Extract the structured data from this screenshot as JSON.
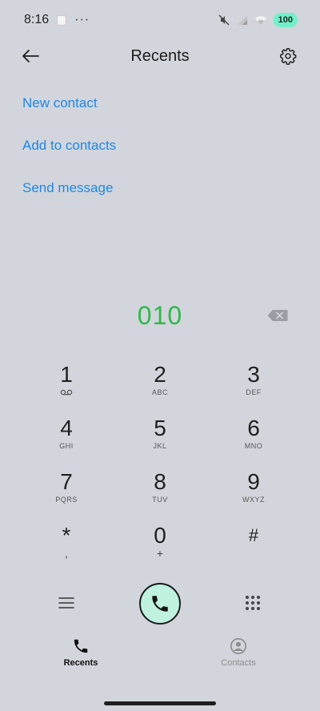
{
  "status_bar": {
    "time": "8:16",
    "overflow_dots": "···",
    "battery": "100"
  },
  "header": {
    "title": "Recents"
  },
  "actions": [
    {
      "label": "New contact"
    },
    {
      "label": "Add to contacts"
    },
    {
      "label": "Send message"
    }
  ],
  "dial": {
    "number": "010"
  },
  "keys": [
    {
      "digit": "1",
      "letters": "",
      "glyph": "voicemail-icon"
    },
    {
      "digit": "2",
      "letters": "ABC"
    },
    {
      "digit": "3",
      "letters": "DEF"
    },
    {
      "digit": "4",
      "letters": "GHI"
    },
    {
      "digit": "5",
      "letters": "JKL"
    },
    {
      "digit": "6",
      "letters": "MNO"
    },
    {
      "digit": "7",
      "letters": "PQRS"
    },
    {
      "digit": "8",
      "letters": "TUV"
    },
    {
      "digit": "9",
      "letters": "WXYZ"
    },
    {
      "digit": "*",
      "letters": ","
    },
    {
      "digit": "0",
      "letters": "+"
    },
    {
      "digit": "#",
      "letters": ""
    }
  ],
  "tabs": [
    {
      "label": "Recents",
      "active": true
    },
    {
      "label": "Contacts",
      "active": false
    }
  ],
  "colors": {
    "background": "#d2d6dc",
    "link": "#1f87e8",
    "number": "#2fb84a",
    "call_button": "#bff3df",
    "battery": "#72f0c9"
  }
}
